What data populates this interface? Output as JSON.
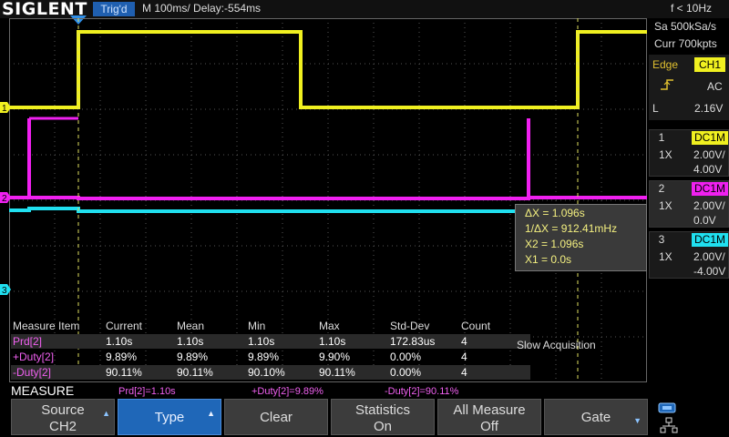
{
  "header": {
    "brand": "SIGLENT",
    "trigger_status": "Trig'd",
    "timebase": "M 100ms/",
    "delay": "Delay:-554ms",
    "frequency": "f < 10Hz"
  },
  "acquisition": {
    "sample_rate": "Sa 500kSa/s",
    "memory": "Curr 700kpts"
  },
  "trigger": {
    "type": "Edge",
    "source": "CH1",
    "coupling": "AC",
    "level_label": "L",
    "level": "2.16V"
  },
  "channels": [
    {
      "num": "1",
      "coupling": "DC1M",
      "probe": "1X",
      "scale": "2.00V/",
      "offset": "4.00V",
      "color": "#f0f020"
    },
    {
      "num": "2",
      "coupling": "DC1M",
      "probe": "1X",
      "scale": "2.00V/",
      "offset": "0.0V",
      "color": "#f020f0"
    },
    {
      "num": "3",
      "coupling": "DC1M",
      "probe": "1X",
      "scale": "2.00V/",
      "offset": "-4.00V",
      "color": "#20e0f0"
    }
  ],
  "markers": {
    "ch1": "1",
    "ch2": "2",
    "ch3": "3"
  },
  "cursors": {
    "delta_x": "ΔX = 1.096s",
    "inv_delta_x": "1/ΔX = 912.41mHz",
    "x2": "X2 = 1.096s",
    "x1": "X1 = 0.0s"
  },
  "measure_table": {
    "headers": [
      "Measure Item",
      "Current",
      "Mean",
      "Min",
      "Max",
      "Std-Dev",
      "Count"
    ],
    "rows": [
      {
        "item": "Prd[2]",
        "current": "1.10s",
        "mean": "1.10s",
        "min": "1.10s",
        "max": "1.10s",
        "stddev": "172.83us",
        "count": "4"
      },
      {
        "item": "+Duty[2]",
        "current": "9.89%",
        "mean": "9.89%",
        "min": "9.89%",
        "max": "9.90%",
        "stddev": "0.00%",
        "count": "4"
      },
      {
        "item": "-Duty[2]",
        "current": "90.11%",
        "mean": "90.11%",
        "min": "90.10%",
        "max": "90.11%",
        "stddev": "0.00%",
        "count": "4"
      }
    ]
  },
  "status": "Slow Acquisition",
  "measure_label": "MEASURE",
  "measure_summary": [
    "Prd[2]=1.10s",
    "+Duty[2]=9.89%",
    "-Duty[2]=90.11%"
  ],
  "softkeys": [
    {
      "top": "Source",
      "bottom": "CH2"
    },
    {
      "top": "Type",
      "bottom": ""
    },
    {
      "top": "Clear",
      "bottom": ""
    },
    {
      "top": "Statistics",
      "bottom": "On"
    },
    {
      "top": "All Measure",
      "bottom": "Off"
    },
    {
      "top": "Gate",
      "bottom": ""
    }
  ],
  "icons": [
    "trigger-rising-edge-icon",
    "network-icon",
    "usb-icon",
    "arrow-up-icon",
    "arrow-down-icon"
  ]
}
